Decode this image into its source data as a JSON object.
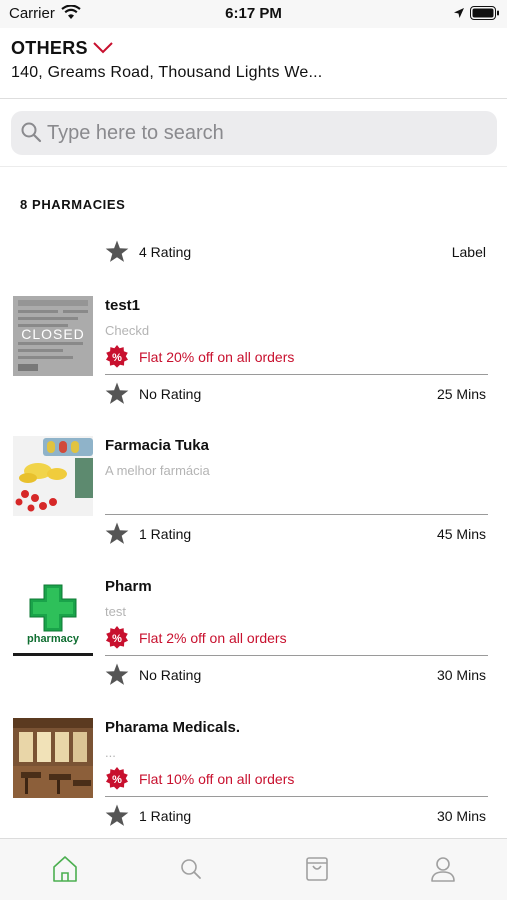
{
  "status_bar": {
    "carrier": "Carrier",
    "time": "6:17 PM"
  },
  "header": {
    "location_label": "OTHERS",
    "address": "140, Greams Road, Thousand Lights We..."
  },
  "search": {
    "placeholder": "Type here to search"
  },
  "section_title": "8 PHARMACIES",
  "top_row": {
    "rating": "4 Rating",
    "meta": "Label"
  },
  "pharmacies": [
    {
      "name": "test1",
      "description": "Checkd",
      "offer": "Flat 20% off on all orders",
      "rating": "No Rating",
      "time": "25 Mins",
      "thumb_overlay": "CLOSED",
      "thumb_icon": "closed-store-thumbnail"
    },
    {
      "name": "Farmacia Tuka",
      "description": "A melhor farmácia",
      "offer": "",
      "rating": "1 Rating",
      "time": "45 Mins",
      "thumb_icon": "pills-thumbnail"
    },
    {
      "name": "Pharm",
      "description": "test",
      "offer": "Flat 2% off on all orders",
      "rating": "No Rating",
      "time": "30 Mins",
      "thumb_text": "pharmacy",
      "thumb_icon": "pharmacy-cross-logo"
    },
    {
      "name": "Pharama Medicals.",
      "description": "...",
      "offer": "Flat 10% off on all orders",
      "rating": "1 Rating",
      "time": "30 Mins",
      "thumb_icon": "interior-photo-thumbnail"
    }
  ],
  "tabs": [
    {
      "icon": "home-icon",
      "active": true
    },
    {
      "icon": "search-icon",
      "active": false
    },
    {
      "icon": "orders-bag-icon",
      "active": false
    },
    {
      "icon": "profile-icon",
      "active": false
    }
  ],
  "colors": {
    "accent_red": "#c8102e",
    "active_tab_green": "#4caf50",
    "inactive_tab_gray": "#a0a0a0",
    "pharmacy_green": "#1aa34a",
    "star_gray": "#555555"
  }
}
